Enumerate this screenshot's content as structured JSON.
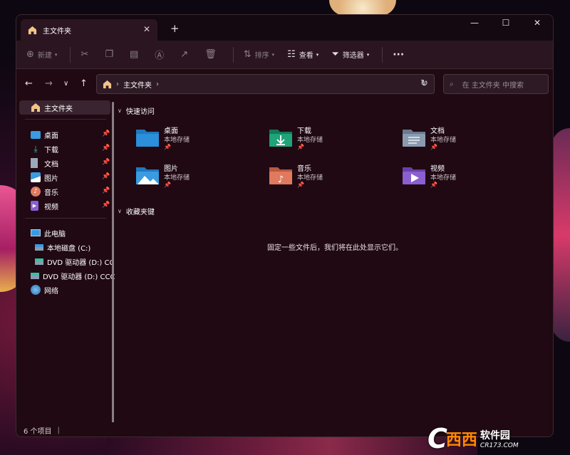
{
  "window": {
    "tab_title": "主文件夹",
    "new_tab": "+",
    "tab_close": "✕",
    "caption": {
      "min": "—",
      "max": "☐",
      "close": "✕"
    }
  },
  "toolbar": {
    "new_label": "新建",
    "sort_label": "排序",
    "view_label": "查看",
    "filter_label": "筛选器",
    "more": "···"
  },
  "nav": {
    "back": "←",
    "forward": "→",
    "history": "∨",
    "up": "↑",
    "refresh": "↻",
    "address": "主文件夹",
    "search_placeholder": "在 主文件夹 中搜索"
  },
  "sidebar": {
    "home": "主文件夹",
    "quick": [
      {
        "label": "桌面"
      },
      {
        "label": "下载"
      },
      {
        "label": "文档"
      },
      {
        "label": "图片"
      },
      {
        "label": "音乐"
      },
      {
        "label": "视频"
      }
    ],
    "this_pc": "此电脑",
    "drives": [
      {
        "label": "本地磁盘 (C:)"
      },
      {
        "label": "DVD 驱动器 (D:) CC"
      }
    ],
    "dvd": "DVD 驱动器 (D:) CCC",
    "network": "网络"
  },
  "main": {
    "quick_access": "快速访问",
    "favorites": "收藏夹键",
    "storage": "本地存储",
    "folders": [
      {
        "name": "桌面",
        "color": "#2b8fd9"
      },
      {
        "name": "下载",
        "color": "#1fa37a"
      },
      {
        "name": "文档",
        "color": "#8a9bb0"
      },
      {
        "name": "图片",
        "color": "#3a9be0"
      },
      {
        "name": "音乐",
        "color": "#e07a5f"
      },
      {
        "name": "视频",
        "color": "#8b5fd0"
      }
    ],
    "empty_msg": "固定一些文件后，我们将在此处显示它们。"
  },
  "status": {
    "items": "6 个项目",
    "bar": "|"
  },
  "watermark": {
    "c": "C",
    "xx": "西西",
    "name": "软件园",
    "url": "CR173.COM"
  }
}
